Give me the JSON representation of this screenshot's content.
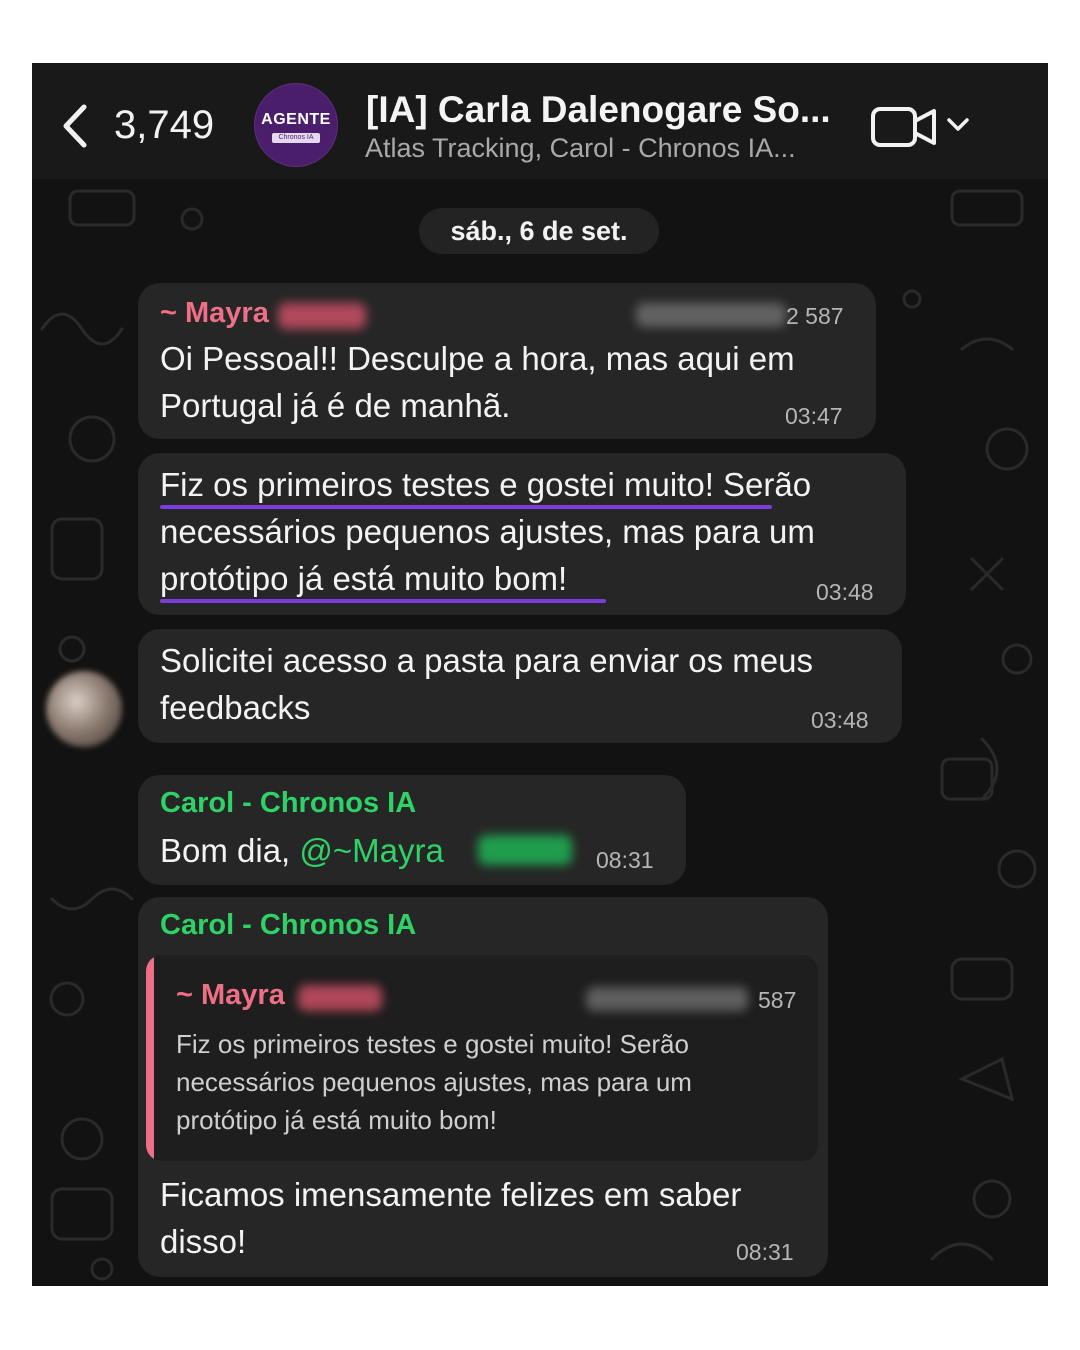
{
  "header": {
    "back_count": "3,749",
    "avatar": {
      "title": "AGENTE",
      "subtitle": "Chronos IA"
    },
    "title": "[IA] Carla Dalenogare So...",
    "subtitle": "Atlas Tracking, Carol - Chronos IA..."
  },
  "date_separator": "sáb., 6 de set.",
  "messages": [
    {
      "sender": "~ Mayra",
      "phone_suffix": "2 587",
      "text": "Oi Pessoal!! Desculpe a hora, mas aqui em Portugal já é de manhã.",
      "time": "03:47"
    },
    {
      "text": "Fiz os primeiros testes e gostei muito! Serão necessários pequenos ajustes, mas para um protótipo já está muito bom!",
      "time": "03:48"
    },
    {
      "text": "Solicitei acesso a pasta para enviar os meus feedbacks",
      "time": "03:48"
    },
    {
      "sender": "Carol - Chronos IA",
      "text": "Bom dia, ",
      "mention": "@~Mayra",
      "time": "08:31"
    },
    {
      "sender": "Carol - Chronos IA",
      "quote": {
        "sender": "~ Mayra",
        "phone_suffix": "587",
        "text": "Fiz os primeiros testes e gostei muito! Serão necessários pequenos ajustes, mas para um protótipo já está muito bom!"
      },
      "text": "Ficamos imensamente felizes em saber disso!",
      "time": "08:31"
    }
  ],
  "colors": {
    "mention_sender": "#ee6f86",
    "own_sender": "#2fd266",
    "underline": "#7d3cde",
    "bubble": "#262626",
    "background": "#121212"
  },
  "icons": [
    "chevron-left-icon",
    "video-camera-icon",
    "chevron-down-icon"
  ]
}
